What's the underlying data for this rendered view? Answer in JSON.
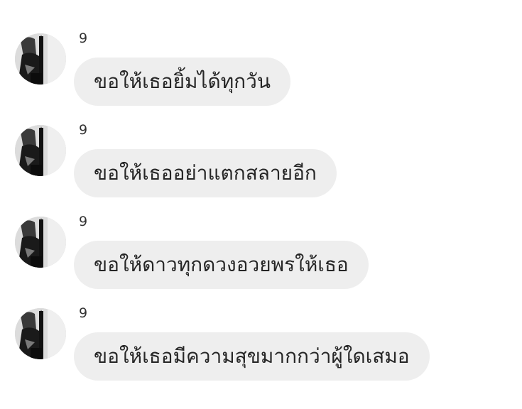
{
  "messages": [
    {
      "sender": "9",
      "text": "ขอให้เธอยิ้มได้ทุกวัน"
    },
    {
      "sender": "9",
      "text": "ขอให้เธออย่าแตกสลายอีก"
    },
    {
      "sender": "9",
      "text": "ขอให้ดาวทุกดวงอวยพรให้เธอ"
    },
    {
      "sender": "9",
      "text": "ขอให้เธอมีความสุขมากกว่าผู้ใดเสมอ"
    }
  ],
  "colors": {
    "bubble_background": "#eeeeee",
    "message_text": "#262626",
    "sender_text": "#333333",
    "page_background": "#ffffff"
  },
  "icons": {
    "avatar": "profile-photo-icon"
  }
}
